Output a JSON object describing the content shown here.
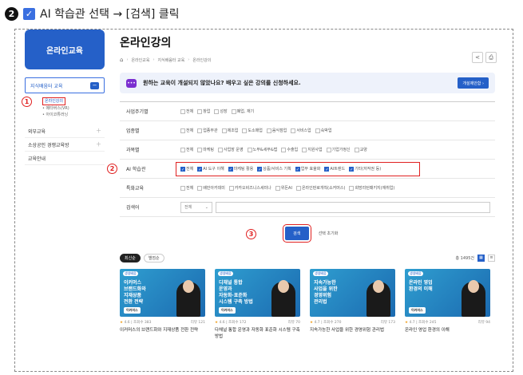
{
  "step": {
    "number": "2",
    "text": "AI 학습관 선택 → [검색] 클릭"
  },
  "sidebar": {
    "logo": "온라인교육",
    "group": {
      "label": "지식배움터 교육",
      "toggle": "−"
    },
    "subitems": [
      "온라인강의",
      "• 메타버스(VR)",
      "• 아이코튜러닝"
    ],
    "active_marker": "1",
    "menu": [
      {
        "label": "외부교육",
        "has_plus": true
      },
      {
        "label": "소상공인 경쟁교육방",
        "has_plus": true
      },
      {
        "label": "교육안내",
        "has_plus": false
      }
    ]
  },
  "main": {
    "title": "온라인강의",
    "breadcrumb": [
      "⌂",
      "온라인교육",
      "지식배움터 교육",
      "온라인강의"
    ],
    "tools": [
      "share-icon",
      "print-icon"
    ],
    "banner": {
      "text": "원하는 교육이 개설되지 않았나요? 배우고 싶은 강의를 신청하세요.",
      "button": "개설제안함 ›"
    },
    "filters": [
      {
        "label": "사업주기별",
        "options": [
          [
            "전체",
            false
          ],
          [
            "창업",
            false
          ],
          [
            "성장",
            false
          ],
          [
            "폐업, 재기",
            false
          ]
        ]
      },
      {
        "label": "업종별",
        "options": [
          [
            "전체",
            false
          ],
          [
            "업종무관",
            false
          ],
          [
            "제조업",
            false
          ],
          [
            "도소매업",
            false
          ],
          [
            "음식점업",
            false
          ],
          [
            "서비스업",
            false
          ],
          [
            "숙박업",
            false
          ]
        ]
      },
      {
        "label": "과목별",
        "options": [
          [
            "전체",
            false
          ],
          [
            "마케팅",
            false
          ],
          [
            "사업장 운영",
            false
          ],
          [
            "노무&세무&법",
            false
          ],
          [
            "수출입",
            false
          ],
          [
            "지원사업",
            false
          ],
          [
            "기업가정신",
            false
          ],
          [
            "교양",
            false
          ]
        ]
      },
      {
        "label": "AI 학습관",
        "options": [
          [
            "전체",
            true
          ],
          [
            "AI 도구 이해",
            true
          ],
          [
            "마케팅 활용",
            true
          ],
          [
            "상품/서비스 기획",
            true
          ],
          [
            "업무 효율화",
            true
          ],
          [
            "AI트렌드",
            true
          ],
          [
            "기타(저작권 등)",
            true
          ]
        ],
        "marker": "2"
      },
      {
        "label": "특화교육",
        "options": [
          [
            "전체",
            false
          ],
          [
            "배민아카데미",
            false
          ],
          [
            "카카오비즈니스세미나",
            false
          ],
          [
            "위돈AI",
            false
          ],
          [
            "온라인판로개척(쇼커머스)",
            false
          ],
          [
            "희망리턴패키지(재취업)",
            false
          ]
        ]
      }
    ],
    "search": {
      "label": "검색어",
      "select": "전체",
      "select_icon": "chevron-down-icon"
    },
    "buttons": {
      "search": "검색",
      "reset": "선택 초기화",
      "marker": "3"
    },
    "list": {
      "sort": [
        "최신순",
        "별점순"
      ],
      "total": "총 1495건",
      "cards": [
        {
          "badge": "생생배움",
          "thumb_title": "이커머스\n브랜드화와\n지재상품\n전환 전략",
          "chip": "이커머스",
          "rating": "4.6",
          "views": "조회수 383",
          "reviews": "리뷰 121",
          "title": "이커머스의 브랜드화와 지재상품 전환 전략"
        },
        {
          "badge": "생생배움",
          "thumb_title": "디채널 통합\n운영과\n자동화·표준화\n시스템 구축 방법",
          "chip": "이커머스",
          "rating": "4.6",
          "views": "조회수 172",
          "reviews": "리뷰 70",
          "title": "다채널 통합 운영과 자동화 표준화 시스템 구축 방법"
        },
        {
          "badge": "생생배움",
          "thumb_title": "지속가능한\n사업을 위한\n경영위험\n관리법",
          "chip": "",
          "rating": "4.7",
          "views": "조회수 270",
          "reviews": "리뷰 173",
          "title": "지속가능한 사업을 위한 경영위험 관리법"
        },
        {
          "badge": "생생배움",
          "thumb_title": "온라인 영업\n환경의 이해",
          "chip": "이커머스",
          "rating": "4.7",
          "views": "조회수 245",
          "reviews": "리뷰 94",
          "title": "온라인 영업 환경의 이해"
        }
      ]
    }
  }
}
